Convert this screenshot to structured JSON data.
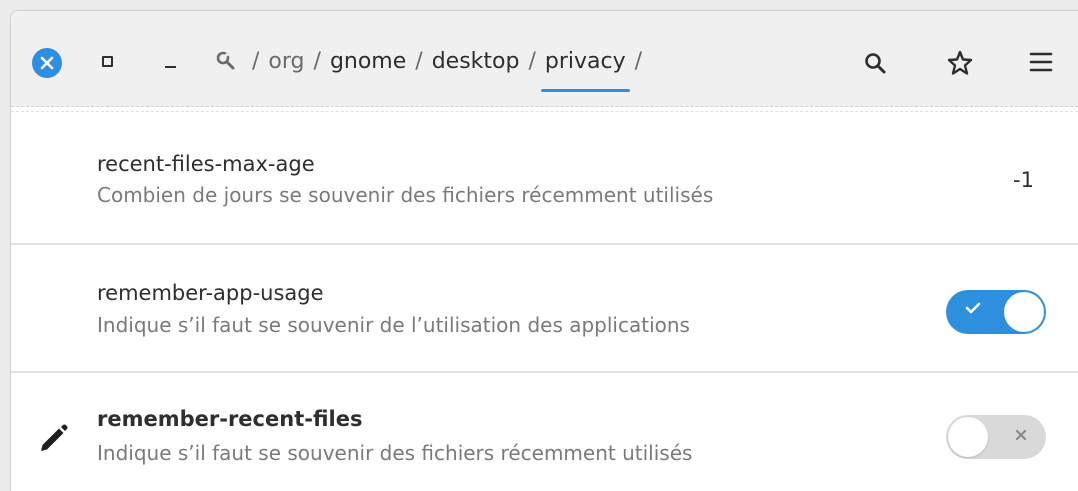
{
  "header": {
    "close_icon": "close-icon",
    "maximize_icon": "maximize-icon",
    "minimize_icon": "minimize-icon",
    "path": {
      "root_icon": "root-icon",
      "separator": "/",
      "segments": [
        "org",
        "gnome",
        "desktop",
        "privacy"
      ],
      "active_segment": "privacy",
      "trailing_separator": "/"
    },
    "search_icon": "search-icon",
    "bookmark_icon": "star-icon",
    "menu_icon": "hamburger-menu-icon"
  },
  "keys": [
    {
      "name": "recent-files-max-age",
      "description": "Combien de jours se souvenir des fichiers récemment utilisés",
      "value": "-1",
      "modified": false
    },
    {
      "name": "remember-app-usage",
      "description": "Indique s’il faut se souvenir de l’utilisation des applications",
      "toggle": true,
      "modified": false
    },
    {
      "name": "remember-recent-files",
      "description": "Indique s’il faut se souvenir des fichiers récemment utilisés",
      "toggle": false,
      "modified": true,
      "modified_icon": "pencil-icon"
    }
  ],
  "colors": {
    "accent": "#2f8fdf",
    "toggle_off": "#d9d9d9",
    "description_text": "#7a7a7a"
  }
}
